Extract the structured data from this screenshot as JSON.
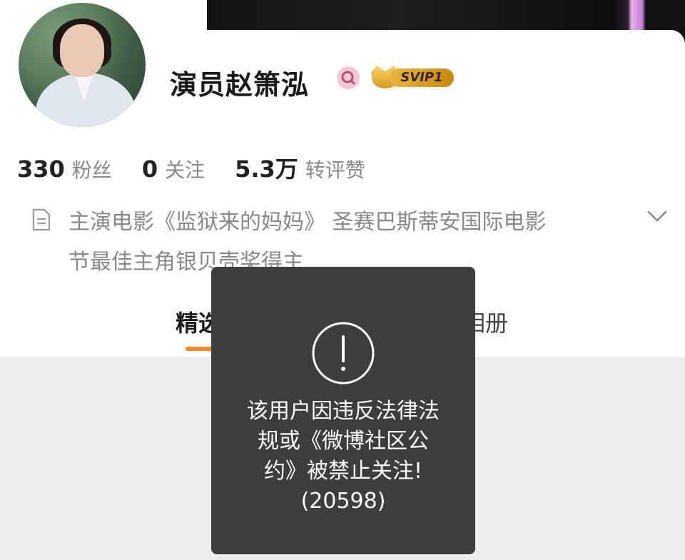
{
  "profile": {
    "username": "演员赵箫泓",
    "vip_label": "SVIP1"
  },
  "stats": [
    {
      "value": "330",
      "label": "粉丝"
    },
    {
      "value": "0",
      "label": "关注"
    },
    {
      "value": "5.3万",
      "label": "转评赞"
    }
  ],
  "bio": {
    "text": "主演电影《监狱来的妈妈》 圣赛巴斯蒂安国际电影节最佳主角银贝壳奖得主"
  },
  "tabs": {
    "left_partial": "精选",
    "right_partial": "相册"
  },
  "toast": {
    "line1": "该用户因违反法律法",
    "line2": "规或《微博社区公",
    "line3": "约》被禁止关注!",
    "code": "(20598)"
  },
  "colors": {
    "accent_orange": "#f08a2c",
    "toast_bg": "#3d3d3d",
    "vip_gold": "#e8b640"
  }
}
